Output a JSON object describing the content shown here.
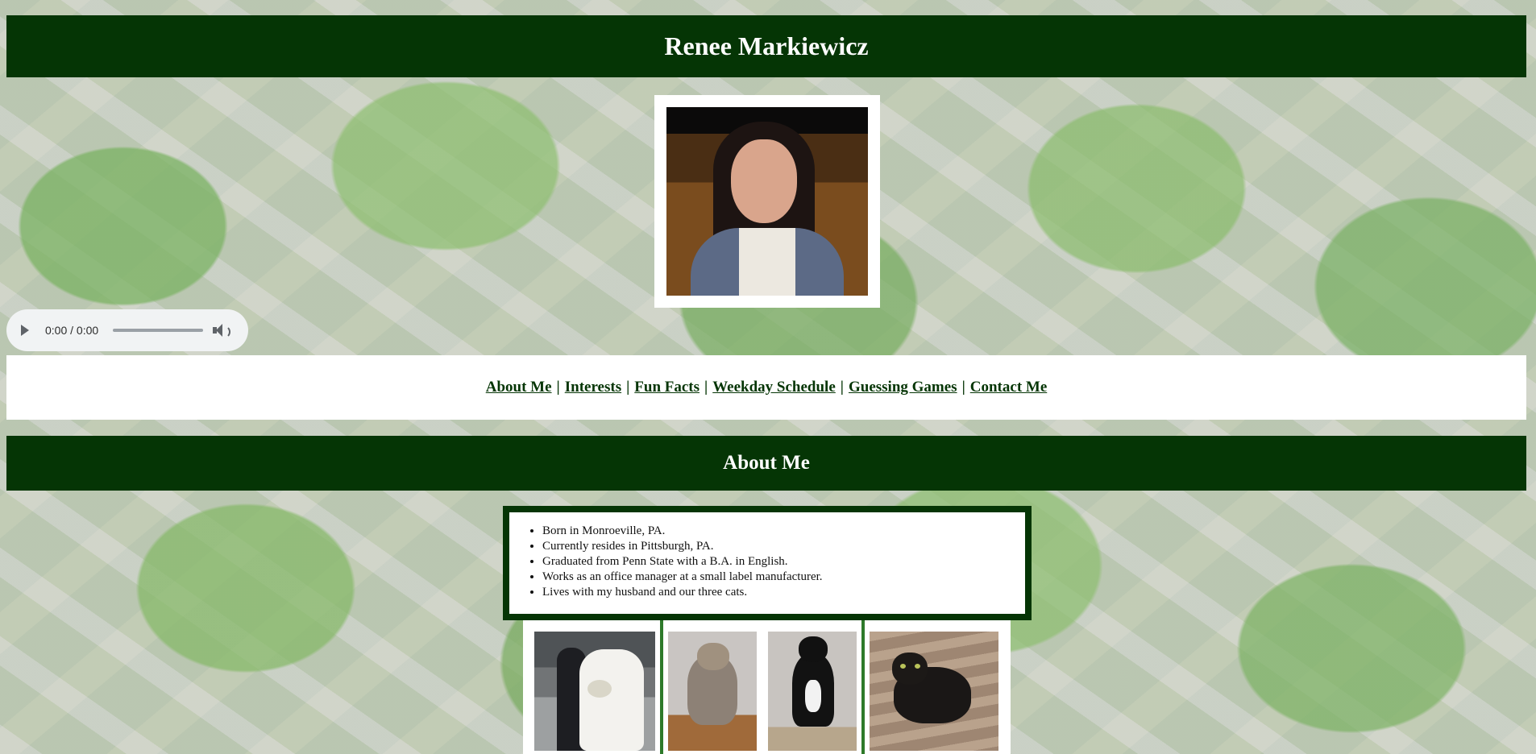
{
  "header": {
    "title": "Renee Markiewicz"
  },
  "audio": {
    "time_display": "0:00 / 0:00",
    "progress": 0
  },
  "nav": {
    "links": [
      "About Me",
      "Interests",
      "Fun Facts",
      "Weekday Schedule",
      "Guessing Games",
      "Contact Me"
    ],
    "separator": "|"
  },
  "about": {
    "heading": "About Me",
    "items": [
      "Born in Monroeville, PA.",
      "Currently resides in Pittsburgh, PA.",
      "Graduated from Penn State with a B.A. in English.",
      "Works as an office manager at a small label manufacturer.",
      "Lives with my husband and our three cats."
    ]
  },
  "colors": {
    "banner": "#053505",
    "link": "#053505",
    "divider": "#2e7a2a"
  }
}
